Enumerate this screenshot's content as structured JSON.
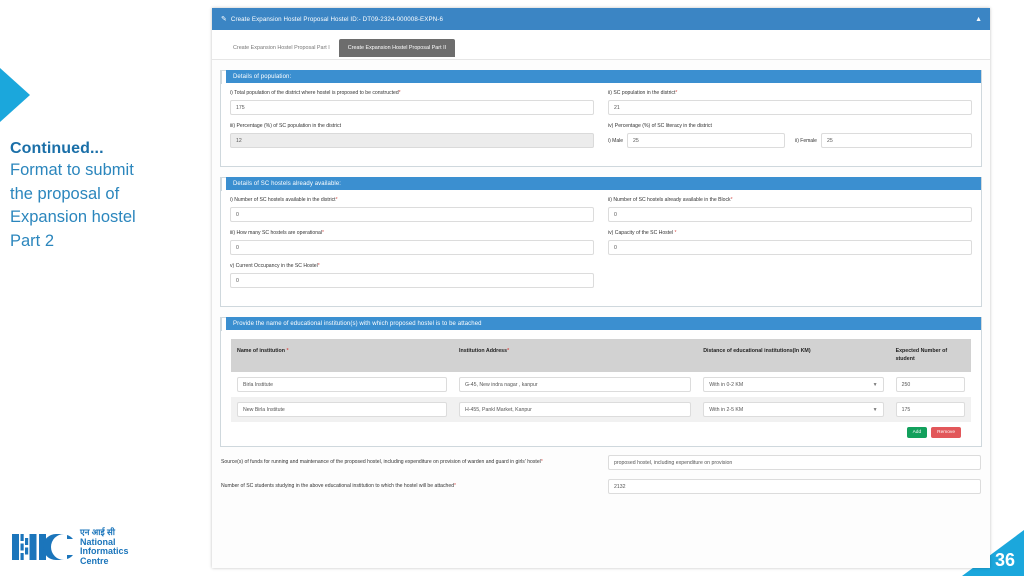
{
  "slide": {
    "heading": "Continued...",
    "body_lines": [
      "Format to submit",
      "the proposal of",
      "Expansion hostel",
      "Part 2"
    ],
    "page_number": "36",
    "accent": "#1ba7dc",
    "text_color": "#2b86bd"
  },
  "logo": {
    "mark": "NIC",
    "hindi": "एन आई सी",
    "line1": "National",
    "line2": "Informatics",
    "line3": "Centre",
    "color": "#1b75bb"
  },
  "window": {
    "title": "Create Expansion Hostel Proposal Hostel ID:- DT09-2324-000008-EXPN-6",
    "edit_icon": "pencil-icon",
    "collapse_icon": "chevron-up-icon",
    "header_color": "#3b85c4"
  },
  "tabs": [
    {
      "label": "Create Expansion Hostel Proposal Part I",
      "active": false
    },
    {
      "label": "Create Expansion Hostel Proposal Part II",
      "active": true
    }
  ],
  "population": {
    "title": "Details of population:",
    "total_population": {
      "label": "i) Total population of the district where hostel is proposed to be constructed",
      "required": true,
      "value": "175"
    },
    "sc_population": {
      "label": "ii) SC population in the district",
      "required": true,
      "value": "21"
    },
    "sc_percentage": {
      "label": "iii) Percentage (%) of SC population in the district",
      "required": false,
      "value": "12",
      "readonly": true
    },
    "literacy": {
      "label": "iv) Percentage (%) of SC literacy in the district",
      "male_label": "i) Male",
      "male_value": "25",
      "female_label": "ii) Female",
      "female_value": "25"
    }
  },
  "hostels": {
    "title": "Details of SC hostels already available:",
    "fields": [
      {
        "label": "i) Number of SC hostels available in the district",
        "required": true,
        "value": "0"
      },
      {
        "label": "ii) Number of SC hostels already available in the Block",
        "required": true,
        "value": "0"
      },
      {
        "label": "iii) How many SC hostels are operational",
        "required": true,
        "value": "0"
      },
      {
        "label": "iv) Capacity of the SC Hostel ",
        "required": true,
        "value": "0"
      },
      {
        "label": "v) Current Occupancy in the SC Hostel",
        "required": true,
        "value": "0"
      }
    ]
  },
  "institutions": {
    "title": "Provide the name of educational institution(s) with which proposed hostel is to be attached",
    "columns": [
      {
        "label": "Name of institution ",
        "required": true
      },
      {
        "label": "Institution Address",
        "required": true
      },
      {
        "label": "Distance of educational institutions(In KM)",
        "required": false
      },
      {
        "label": "Expected Number of student",
        "required": false
      }
    ],
    "rows": [
      {
        "name": "Birla Institute",
        "address": "G-45, New indra nagar , kanpur",
        "distance": "With in 0-2 KM",
        "students": "250"
      },
      {
        "name": "New Birla Institute",
        "address": "H-455, Pankl Market, Kanpur",
        "distance": "With in 2-5 KM",
        "students": "175"
      }
    ],
    "caret_icon": "chevron-down-icon",
    "add_label": "Add",
    "remove_label": "Remove",
    "add_color": "#12a05c",
    "remove_color": "#e2575a"
  },
  "footer_fields": [
    {
      "label": "Source(s) of funds for running and maintenance of the proposed hostel, including expenditure on provision of warden and guard in girls' hostel",
      "required": true,
      "value": "proposed hostel, including expenditure on provision"
    },
    {
      "label": "Number of SC students studying in the above educational institution to which the hostel will be attached",
      "required": true,
      "value": "2132"
    }
  ]
}
